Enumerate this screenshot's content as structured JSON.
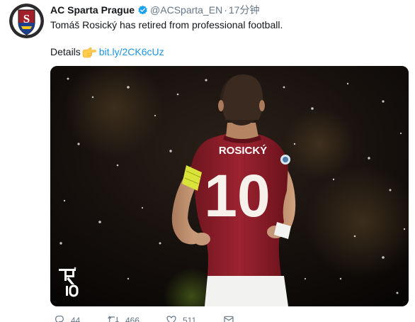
{
  "tweet": {
    "account_name": "AC Sparta Prague",
    "handle": "@ACSparta_EN",
    "separator": "·",
    "time": "17分钟",
    "text": "Tomáš Rosický has retired from professional football.",
    "details_label": "Details",
    "link": "bit.ly/2CK6cUz",
    "photo": {
      "jersey_name": "ROSICKÝ",
      "jersey_number": "10",
      "logo_text": "R10"
    },
    "actions": {
      "reply_count": "44",
      "retweet_count": "466",
      "like_count": "511"
    }
  },
  "colors": {
    "link": "#1b95e0",
    "verified": "#1da1f2",
    "jersey": "#8e1d27",
    "muted": "#657786"
  },
  "icons": [
    "sparta-crest-icon",
    "verified-badge-icon",
    "pointing-hand-icon",
    "reply-icon",
    "retweet-icon",
    "like-icon",
    "message-icon"
  ]
}
